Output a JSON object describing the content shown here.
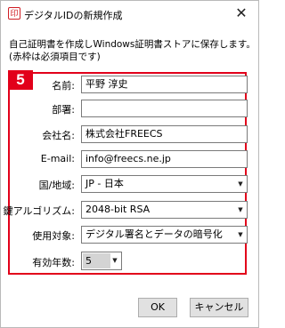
{
  "window": {
    "title": "デジタルIDの新規作成",
    "icon": "app-logo-icon",
    "close_glyph": "✕"
  },
  "description": {
    "line1": "自己証明書を作成しWindows証明書ストアに保存します。",
    "line2": "(赤枠は必須項目です)"
  },
  "step_badge": "5",
  "form": {
    "name": {
      "label": "名前:",
      "value": "平野 淳史"
    },
    "department": {
      "label": "部署:",
      "value": ""
    },
    "company": {
      "label": "会社名:",
      "value": "株式会社FREECS"
    },
    "email": {
      "label": "E-mail:",
      "value": "info@freecs.ne.jp"
    },
    "country": {
      "label": "国/地域:",
      "value": "JP - 日本"
    },
    "algorithm": {
      "label": "鍵アルゴリズム:",
      "value": "2048-bit RSA"
    },
    "usage": {
      "label": "使用対象:",
      "value": "デジタル署名とデータの暗号化"
    },
    "validity": {
      "label": "有効年数:",
      "value": "5"
    }
  },
  "buttons": {
    "ok": "OK",
    "cancel": "キャンセル"
  },
  "colors": {
    "required_border": "#e2001a",
    "badge_background": "#e2001a",
    "button_background": "#e1e1e1"
  }
}
